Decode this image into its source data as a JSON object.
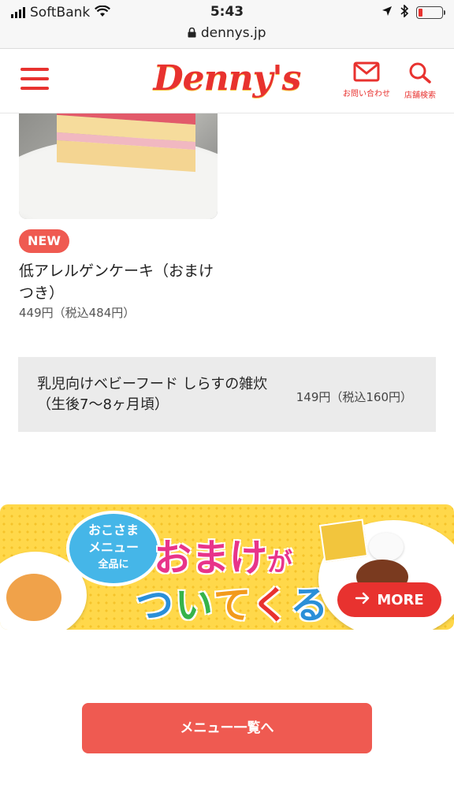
{
  "status_bar": {
    "carrier": "SoftBank",
    "time": "5:43",
    "url": "dennys.jp",
    "battery_color": "#e8322f"
  },
  "header": {
    "logo": "Denny's",
    "contact_label": "お問い合わせ",
    "store_search_label": "店舗検索",
    "accent": "#e8322f",
    "icons": {
      "menu": "hamburger-icon",
      "contact": "mail-icon",
      "search": "search-icon"
    }
  },
  "item": {
    "badge": "NEW",
    "name": "低アレルゲンケーキ（おまけつき）",
    "price": "449円（税込484円）"
  },
  "babyfood": {
    "name": "乳児向けベビーフード しらすの雑炊（生後7〜8ヶ月頃）",
    "price": "149円（税込160円）"
  },
  "banner": {
    "bubble_line1": "おこさま",
    "bubble_line2": "メニュー",
    "bubble_line3": "全品に",
    "headline": "おまけ",
    "headline_suffix": "が",
    "sub_1": "つ",
    "sub_2": "い",
    "sub_3": "て",
    "sub_4": "く",
    "sub_5": "る",
    "more_label": "MORE",
    "more_icon": "arrow-right-icon"
  },
  "menu_list_button": "メニュー一覧へ"
}
